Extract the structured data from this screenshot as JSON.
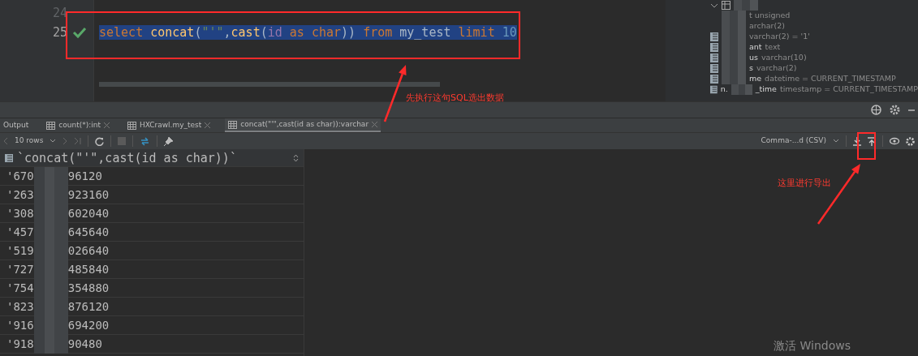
{
  "editor": {
    "lines": [
      {
        "number": "24",
        "checked": false
      },
      {
        "number": "25",
        "checked": true,
        "selected": true,
        "tokens": [
          {
            "kind": "keyword",
            "text": "select "
          },
          {
            "kind": "function",
            "text": "concat"
          },
          {
            "kind": "plain",
            "text": "("
          },
          {
            "kind": "string",
            "text": "\"'\""
          },
          {
            "kind": "plain",
            "text": ","
          },
          {
            "kind": "function",
            "text": "cast"
          },
          {
            "kind": "plain",
            "text": "("
          },
          {
            "kind": "column",
            "text": "id "
          },
          {
            "kind": "keyword",
            "text": "as "
          },
          {
            "kind": "keyword",
            "text": "char"
          },
          {
            "kind": "plain",
            "text": ")) "
          },
          {
            "kind": "keyword",
            "text": "from "
          },
          {
            "kind": "plain",
            "text": "my_test "
          },
          {
            "kind": "keyword",
            "text": "limit "
          },
          {
            "kind": "number",
            "text": "10"
          }
        ]
      }
    ]
  },
  "structure_panel": {
    "expanded": true,
    "rows": [
      {
        "kind": "hidden",
        "type": "t unsigned"
      },
      {
        "kind": "hidden",
        "type": "archar(2)"
      },
      {
        "kind": "column",
        "type": "varchar(2) = '1'"
      },
      {
        "kind": "column",
        "name": "ant",
        "type": "text"
      },
      {
        "kind": "column",
        "name": "us",
        "type": "varchar(10)"
      },
      {
        "kind": "column",
        "name": "s",
        "type": "varchar(2)"
      },
      {
        "kind": "column",
        "name": "me",
        "type": "datetime = CURRENT_TIMESTAMP"
      },
      {
        "kind": "column",
        "name_start": "n.",
        "name": "_time",
        "type": "timestamp = CURRENT_TIMESTAMP"
      }
    ]
  },
  "result_tabs": [
    {
      "label": "Output",
      "kind": "console",
      "selected": false
    },
    {
      "label": "count(*):int",
      "kind": "table",
      "selected": false
    },
    {
      "label": "HXCrawl.my_test",
      "kind": "table",
      "selected": false
    },
    {
      "label": "concat(\"'\",cast(id as char)):varchar",
      "kind": "table",
      "selected": true
    }
  ],
  "toolbar": {
    "rows": "10 rows",
    "format": "Comma-...d (CSV)"
  },
  "grid": {
    "column": "`concat(\"'\",cast(id as char))`",
    "rows": [
      {
        "start": "'670",
        "end": "96120"
      },
      {
        "start": "'263",
        "end": "923160"
      },
      {
        "start": "'308",
        "end": "602040"
      },
      {
        "start": "'457",
        "end": "645640"
      },
      {
        "start": "'519",
        "end": "026640"
      },
      {
        "start": "'727",
        "end": "485840"
      },
      {
        "start": "'754",
        "end": "354880"
      },
      {
        "start": "'823",
        "end": "876120"
      },
      {
        "start": "'916",
        "end": "694200"
      },
      {
        "start": "'918",
        "end": "90480"
      }
    ]
  },
  "annotations": [
    {
      "kind": "query",
      "text": "先执行这句SQL选出数据"
    },
    {
      "kind": "export",
      "text": "这里进行导出"
    }
  ],
  "os_notice": "激活 Windows"
}
